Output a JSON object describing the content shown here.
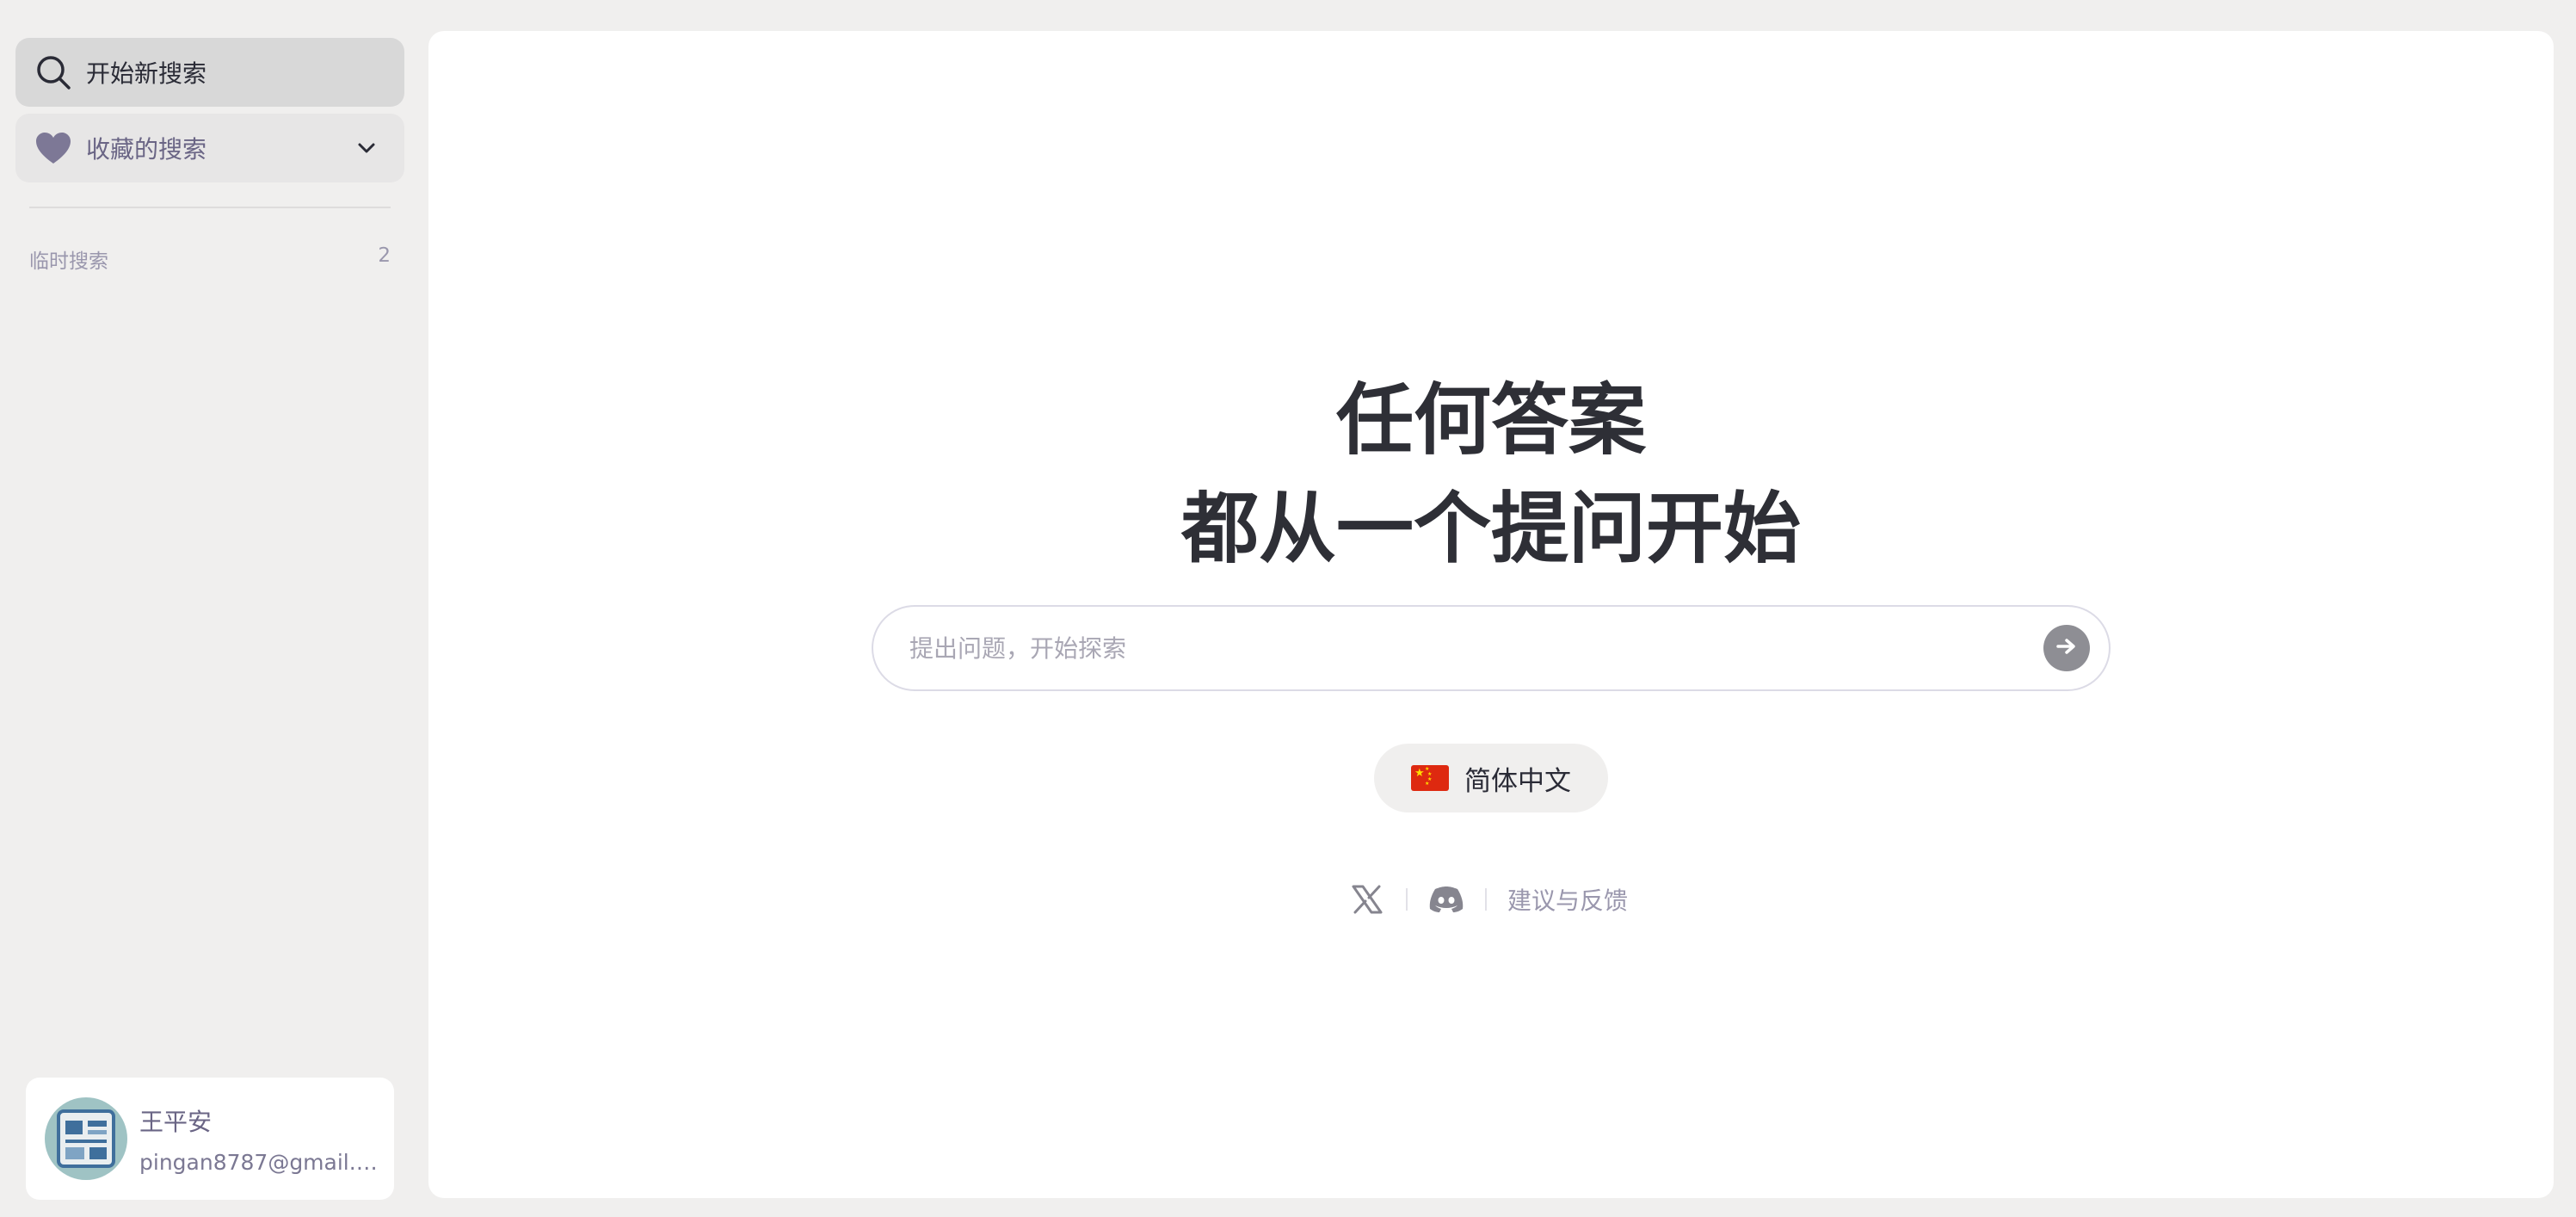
{
  "sidebar": {
    "new_search_label": "开始新搜索",
    "favorites_label": "收藏的搜索",
    "temp_section": {
      "label": "临时搜索",
      "count": "2"
    },
    "user": {
      "name": "王平安",
      "email": "pingan8787@gmail.c..."
    }
  },
  "main": {
    "hero_line1": "任何答案",
    "hero_line2": "都从一个提问开始",
    "search": {
      "placeholder": "提出问题，开始探索",
      "value": ""
    },
    "language_label": "简体中文",
    "feedback_label": "建议与反馈"
  },
  "icons": {
    "search": "search-icon",
    "heart": "heart-icon",
    "chevron": "chevron-down-icon",
    "send": "arrow-right-icon",
    "flag": "china-flag-icon",
    "x": "x-logo-icon",
    "discord": "discord-icon"
  },
  "colors": {
    "background": "#f0efee",
    "panel": "#ffffff",
    "accent_purple": "#6a6585",
    "text_dark": "#2e2f36",
    "muted": "#9a97ad"
  }
}
